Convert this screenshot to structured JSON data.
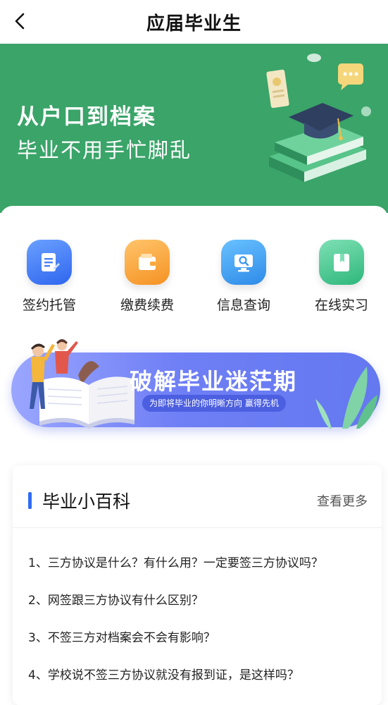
{
  "header": {
    "title": "应届毕业生"
  },
  "hero": {
    "line1": "从户口到档案",
    "line2": "毕业不用手忙脚乱",
    "bg_color": "#3aa469"
  },
  "actions": [
    {
      "label": "签约托管",
      "icon": "document-icon",
      "color": "#3f7af2"
    },
    {
      "label": "缴费续费",
      "icon": "wallet-icon",
      "color": "#f7a13a"
    },
    {
      "label": "信息查询",
      "icon": "monitor-search-icon",
      "color": "#3b97ee"
    },
    {
      "label": "在线实习",
      "icon": "book-icon",
      "color": "#3cc48a"
    }
  ],
  "banner": {
    "title": "破解毕业迷茫期",
    "subtitle": "为即将毕业的你明晰方向 赢得先机"
  },
  "wiki": {
    "title": "毕业小百科",
    "more": "查看更多",
    "items": [
      "1、三方协议是什么？有什么用？一定要签三方协议吗？",
      "2、网签跟三方协议有什么区别？",
      "3、不签三方对档案会不会有影响？",
      "4、学校说不签三方协议就没有报到证，是这样吗？"
    ]
  }
}
